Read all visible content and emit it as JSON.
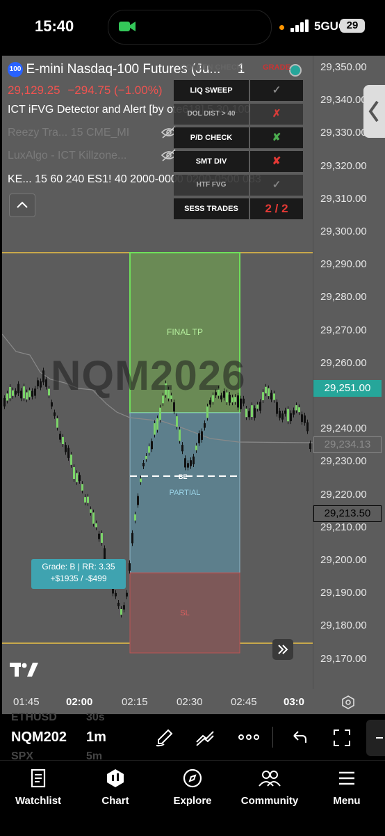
{
  "status_bar": {
    "time": "15:40",
    "network": "5GUC",
    "battery": "29"
  },
  "chart": {
    "symbol_badge": "100",
    "symbol_title": "E-mini Nasdaq-100 Futures (Ju...",
    "interval_suffix": "1",
    "price": "29,129.25",
    "change": "−294.75 (−1.00%)",
    "indicators": [
      "ICT iFVG Detector and Alert [by ote618] 5 30 100",
      "Reezy Tra...   15 CME_MI",
      "LuxAlgo - ICT Killzone...",
      "KE...  15 60 240 ES1! 40 2000-0000 0200-0500 083"
    ],
    "watermark": "NQM2026",
    "boxes": {
      "tp_label": "FINAL TP",
      "partial_label": "PARTIAL",
      "be_label": "BE",
      "sl_label": "SL"
    },
    "grade_label_line1": "Grade: B | RR: 3.35",
    "grade_label_line2": "+$1935 / -$499",
    "current_price_tag": "29,251.00",
    "gray_price_tag": "29,234.13",
    "outline_price_tag": "29,213.50",
    "price_axis_labels": [
      "29,350.00",
      "29,340.00",
      "29,330.00",
      "29,320.00",
      "29,310.00",
      "29,300.00",
      "29,290.00",
      "29,280.00",
      "29,270.00",
      "29,260.00",
      "29,240.00",
      "29,230.00",
      "29,220.00",
      "29,210.00",
      "29,200.00",
      "29,190.00",
      "29,180.00",
      "29,170.00"
    ],
    "time_axis_labels": [
      "01:45",
      "02:00",
      "02:15",
      "02:30",
      "02:45",
      "03:0"
    ],
    "accent_colors": {
      "green": "#4caf50",
      "red": "#e53935",
      "teal": "#26a69a",
      "gold": "#c8a84b"
    }
  },
  "checklist": {
    "header_left": "GOLDEN CHECK",
    "header_right": "GRADE",
    "rows": [
      {
        "label": "LIQ SWEEP",
        "value": "✓",
        "color": "#888888"
      },
      {
        "label": "DOL DIST > 40",
        "value": "✗",
        "color": "#e53935"
      },
      {
        "label": "P/D CHECK",
        "value": "✘",
        "color": "#4caf50"
      },
      {
        "label": "SMT DIV",
        "value": "✘",
        "color": "#e53935"
      },
      {
        "label": "HTF FVG",
        "value": "✓",
        "color": "#888888"
      },
      {
        "label": "SESS TRADES",
        "value": "2 / 2",
        "color": "#e53935"
      }
    ]
  },
  "toolbar": {
    "symbol": "NQM202",
    "interval": "1m",
    "behind_left": [
      "ETHUSD",
      "SPX"
    ],
    "behind_right": [
      "30s",
      "5m"
    ]
  },
  "tabs": [
    {
      "label": "Watchlist",
      "icon": "watchlist-icon"
    },
    {
      "label": "Chart",
      "icon": "chart-icon"
    },
    {
      "label": "Explore",
      "icon": "compass-icon"
    },
    {
      "label": "Community",
      "icon": "community-icon"
    },
    {
      "label": "Menu",
      "icon": "menu-icon"
    }
  ]
}
